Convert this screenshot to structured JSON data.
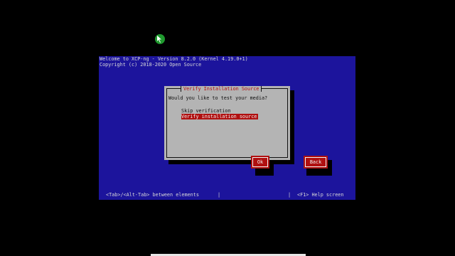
{
  "console": {
    "header_line1": "Welcome to XCP-ng - Version 8.2.0 (Kernel 4.19.0+1)",
    "header_line2": "Copyright (c) 2018-2020 Open Source"
  },
  "dialog": {
    "title": "Verify Installation Source",
    "question": "Would you like to test your media?",
    "options": [
      {
        "label": "Skip verification",
        "selected": false
      },
      {
        "label": "Verify installation source",
        "selected": true
      }
    ],
    "ok_label": "Ok",
    "back_label": "Back"
  },
  "statusbar": {
    "left_text": "<Tab>/<Alt-Tab> between elements",
    "separator": "|",
    "right_text": "<F1> Help screen"
  },
  "colors": {
    "console_background": "#1c149c",
    "dialog_background": "#b4b4b4",
    "accent_red": "#b01010",
    "cursor_green": "#1f9a2e"
  },
  "icons": {
    "cursor": "mouse-pointer-icon"
  }
}
